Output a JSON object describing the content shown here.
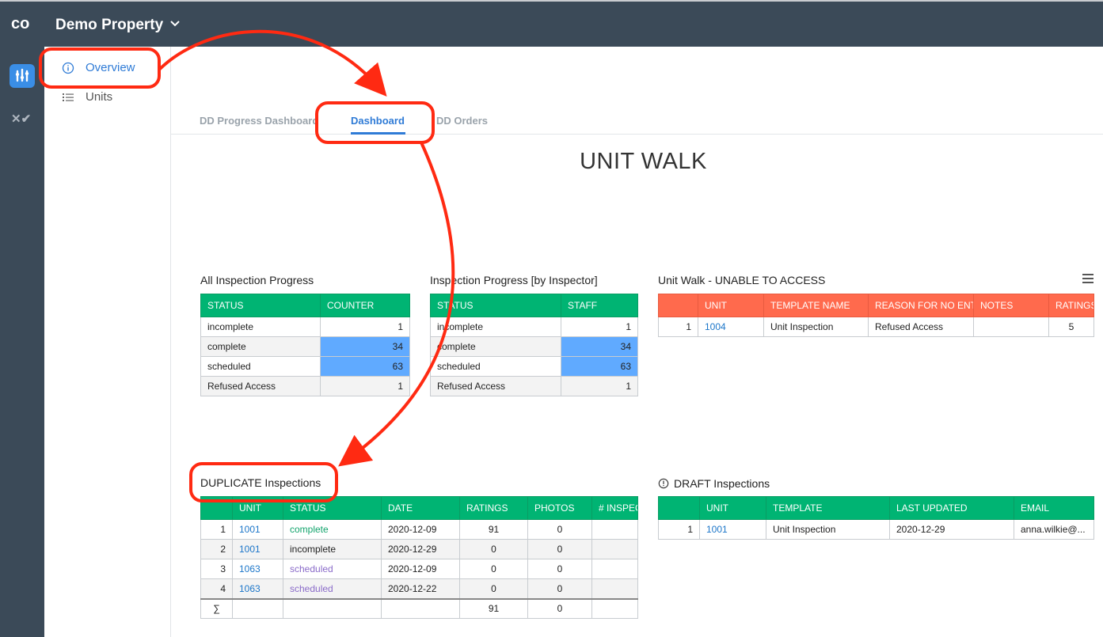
{
  "header": {
    "logo": "co",
    "property": "Demo Property"
  },
  "nav": {
    "overview": "Overview",
    "units": "Units"
  },
  "tabs": [
    {
      "label": "DD Progress Dashboard"
    },
    {
      "label": "Dashboard"
    },
    {
      "label": "DD Orders"
    }
  ],
  "page_title": "UNIT WALK",
  "all_progress": {
    "title": "All Inspection Progress",
    "columns": [
      "STATUS",
      "COUNTER"
    ],
    "rows": [
      {
        "status": "incomplete",
        "value": "1"
      },
      {
        "status": "complete",
        "value": "34"
      },
      {
        "status": "scheduled",
        "value": "63"
      },
      {
        "status": "Refused Access",
        "value": "1"
      }
    ]
  },
  "inspector_progress": {
    "title": "Inspection Progress [by Inspector]",
    "columns": [
      "STATUS",
      "STAFF"
    ],
    "rows": [
      {
        "status": "incomplete",
        "value": "1"
      },
      {
        "status": "complete",
        "value": "34"
      },
      {
        "status": "scheduled",
        "value": "63"
      },
      {
        "status": "Refused Access",
        "value": "1"
      }
    ]
  },
  "unable_access": {
    "title": "Unit Walk - UNABLE TO ACCESS",
    "columns": [
      "",
      "UNIT",
      "TEMPLATE NAME",
      "REASON FOR NO ENTRY",
      "NOTES",
      "RATINGS"
    ],
    "rows": [
      {
        "idx": "1",
        "unit": "1004",
        "template": "Unit Inspection",
        "reason": "Refused Access",
        "notes": "",
        "ratings": "5"
      }
    ]
  },
  "duplicates": {
    "title": "DUPLICATE Inspections",
    "columns": [
      "",
      "UNIT",
      "STATUS",
      "DATE",
      "RATINGS",
      "PHOTOS",
      "# INSPECTIONS"
    ],
    "rows": [
      {
        "idx": "1",
        "unit": "1001",
        "status": "complete",
        "date": "2020-12-09",
        "ratings": "91",
        "photos": "0"
      },
      {
        "idx": "2",
        "unit": "1001",
        "status": "incomplete",
        "date": "2020-12-29",
        "ratings": "0",
        "photos": "0"
      },
      {
        "idx": "3",
        "unit": "1063",
        "status": "scheduled",
        "date": "2020-12-09",
        "ratings": "0",
        "photos": "0"
      },
      {
        "idx": "4",
        "unit": "1063",
        "status": "scheduled",
        "date": "2020-12-22",
        "ratings": "0",
        "photos": "0"
      }
    ],
    "sum": {
      "symbol": "∑",
      "ratings": "91",
      "photos": "0"
    }
  },
  "drafts": {
    "title": "DRAFT Inspections",
    "columns": [
      "",
      "UNIT",
      "TEMPLATE",
      "LAST UPDATED",
      "EMAIL"
    ],
    "rows": [
      {
        "idx": "1",
        "unit": "1001",
        "template": "Unit Inspection",
        "updated": "2020-12-29",
        "email": "anna.wilkie@..."
      }
    ]
  },
  "colors": {
    "header": "#3b4a58",
    "accent": "#2f7bd6",
    "green_header": "#00b473",
    "red_header": "#ff6a4d",
    "highlight": "#60aaff",
    "annotation": "#ff2a12"
  }
}
